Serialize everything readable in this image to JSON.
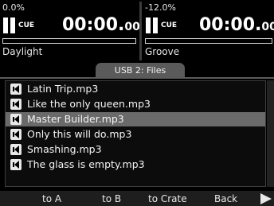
{
  "deck_a": {
    "pitch": "0.0%",
    "cue_label": "CUE",
    "time_main": "00:00.",
    "time_sub": "00",
    "track": "Daylight",
    "progress": 0
  },
  "deck_b": {
    "pitch": "-12.0%",
    "cue_label": "CUE",
    "time_main": "00:00.",
    "time_sub": "00",
    "track": "Groove",
    "progress": 0
  },
  "browser": {
    "tab_label": "USB 2: Files",
    "selected_index": 2,
    "files": [
      "Latin Trip.mp3",
      "Like the only queen.mp3",
      "Master Builder.mp3",
      "Only this will do.mp3",
      "Smashing.mp3",
      "The glass is empty.mp3"
    ]
  },
  "actions": {
    "to_a": "to A",
    "to_b": "to B",
    "to_crate": "to Crate",
    "back": "Back"
  }
}
